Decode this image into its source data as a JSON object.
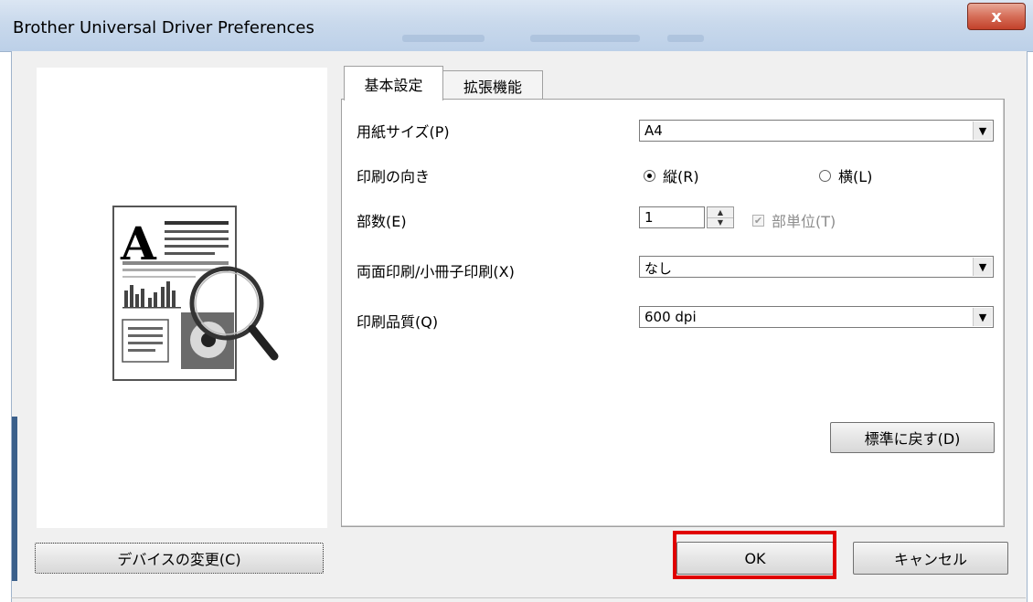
{
  "window": {
    "title": "Brother Universal Driver Preferences",
    "close_glyph": "x"
  },
  "tabs": [
    {
      "label": "基本設定",
      "active": true
    },
    {
      "label": "拡張機能",
      "active": false
    }
  ],
  "form": {
    "paper_size": {
      "label": "用紙サイズ(P)",
      "value": "A4"
    },
    "orientation": {
      "label": "印刷の向き",
      "options": [
        {
          "label": "縦(R)",
          "selected": true
        },
        {
          "label": "横(L)",
          "selected": false
        }
      ]
    },
    "copies": {
      "label": "部数(E)",
      "value": "1",
      "collate_label": "部単位(T)",
      "collate_checked": true,
      "collate_disabled": true
    },
    "duplex": {
      "label": "両面印刷/小冊子印刷(X)",
      "value": "なし"
    },
    "quality": {
      "label": "印刷品質(Q)",
      "value": "600 dpi"
    },
    "default_button": "標準に戻す(D)"
  },
  "buttons": {
    "change_device": "デバイスの変更(C)",
    "ok": "OK",
    "cancel": "キャンセル"
  },
  "colors": {
    "highlight": "#e00000",
    "titlebar": "#c9d9ec",
    "dialog_bg": "#f0f0f0"
  },
  "icons": {
    "preview": "document-preview-magnifier-icon",
    "dropdown": "chevron-down-icon",
    "spin": "spin-up-down-icon",
    "close": "close-icon"
  }
}
